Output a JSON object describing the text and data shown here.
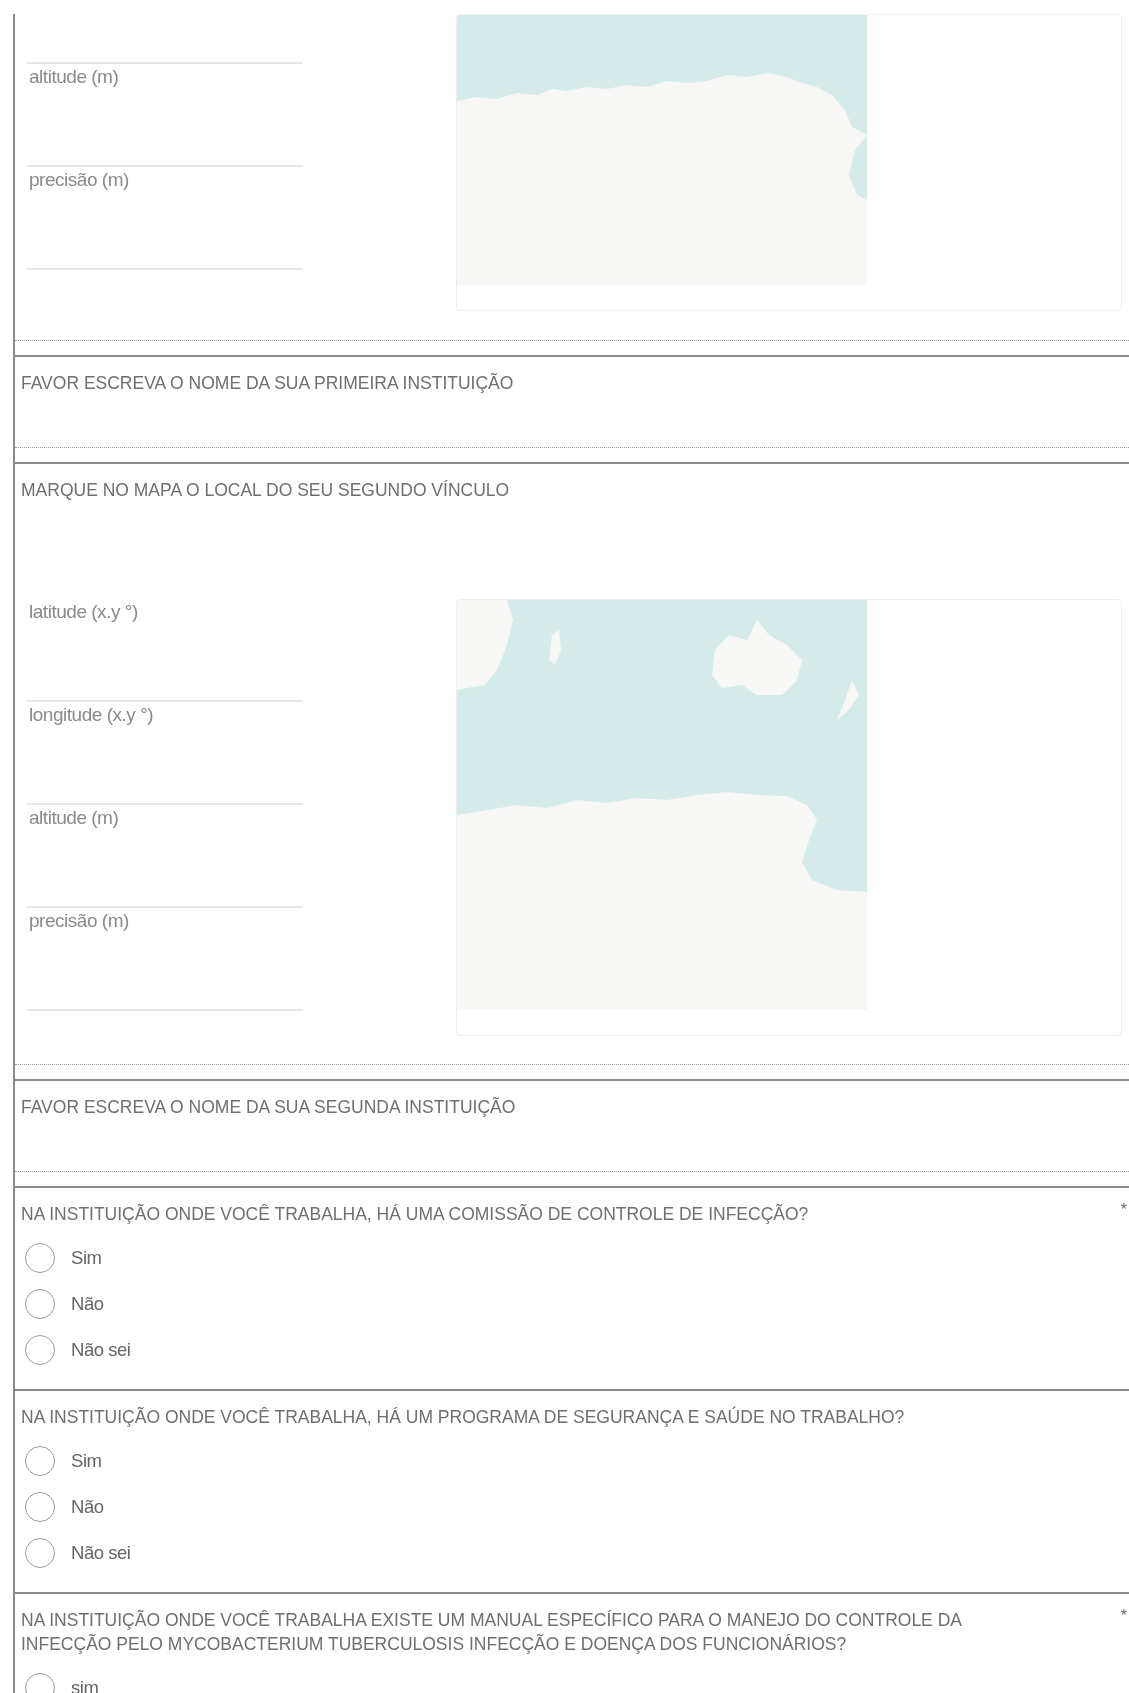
{
  "sections": [
    {
      "kind": "geopoint",
      "fields": [
        {
          "kind": "input_only"
        },
        {
          "kind": "labeled",
          "label": "altitude (m)"
        },
        {
          "kind": "labeled",
          "label": "precisão (m)"
        }
      ],
      "map": {
        "kind": "picture"
      }
    },
    {
      "kind": "text",
      "label": "FAVOR ESCREVA O NOME DA SUA PRIMEIRA INSTITUIÇÃO"
    },
    {
      "kind": "geopoint",
      "label": "MARQUE NO MAPA O LOCAL DO SEU SEGUNDO VÍNCULO",
      "fields": [
        {
          "kind": "labeled",
          "label": "latitude (x.y °)"
        },
        {
          "kind": "labeled",
          "label": "longitude (x.y °)"
        },
        {
          "kind": "labeled",
          "label": "altitude (m)"
        },
        {
          "kind": "labeled",
          "label": "precisão (m)"
        }
      ],
      "map": {
        "kind": "picture"
      }
    },
    {
      "kind": "text",
      "label": "FAVOR ESCREVA O NOME DA SUA SEGUNDA INSTITUIÇÃO"
    },
    {
      "kind": "radio",
      "label": "NA INSTITUIÇÃO ONDE VOCÊ TRABALHA, HÁ UMA COMISSÃO DE CONTROLE DE INFECÇÃO?",
      "required_mark": "*",
      "options": [
        {
          "label": "Sim",
          "selected": false
        },
        {
          "label": "Não",
          "selected": false
        },
        {
          "label": "Não sei",
          "selected": false
        }
      ]
    },
    {
      "kind": "radio",
      "label": "NA INSTITUIÇÃO ONDE VOCÊ TRABALHA, HÁ UM PROGRAMA DE SEGURANÇA E SAÚDE NO TRABALHO?",
      "options": [
        {
          "label": "Sim",
          "selected": false
        },
        {
          "label": "Não",
          "selected": false
        },
        {
          "label": "Não sei",
          "selected": false
        }
      ]
    },
    {
      "kind": "radio",
      "label": "NA INSTITUIÇÃO ONDE VOCÊ TRABALHA EXISTE UM MANUAL ESPECÍFICO PARA O MANEJO DO CONTROLE DA INFECÇÃO PELO MYCOBACTERIUM TUBERCULOSIS INFECÇÃO E DOENÇA DOS FUNCIONÁRIOS?",
      "required_mark": "*",
      "options": [
        {
          "label": "sim",
          "selected": false
        }
      ]
    }
  ]
}
